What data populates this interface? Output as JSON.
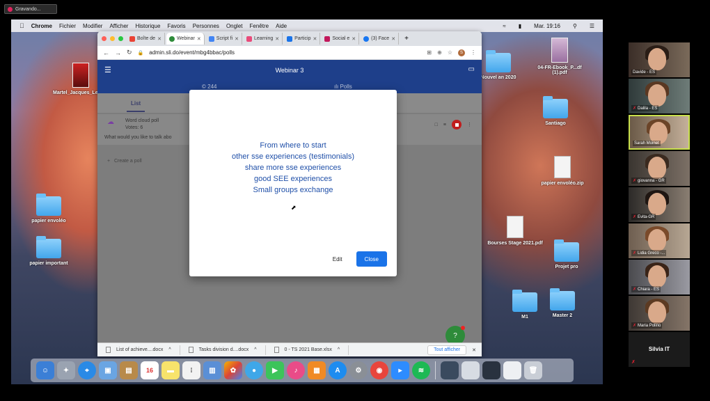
{
  "recording": {
    "label": "Gravando..."
  },
  "menubar": {
    "app": "Chrome",
    "items": [
      "Fichier",
      "Modifier",
      "Afficher",
      "Historique",
      "Favoris",
      "Personnes",
      "Onglet",
      "Fenêtre",
      "Aide"
    ],
    "clock": "Mar. 19:16"
  },
  "desktop": {
    "icons": [
      "Martel_Jacques_Le_grand_ladie",
      "papier envoléo",
      "papier important",
      "Nouvel an 2020",
      "Santiago",
      "papier envoléo.zip",
      "Bourses Stage 2021.pdf",
      "Projet pro",
      "M1",
      "Master 2",
      "04-FR-Ebook_P...df (1).pdf"
    ]
  },
  "chrome": {
    "tabs": [
      {
        "label": "Boîte de"
      },
      {
        "label": "Webinar"
      },
      {
        "label": "Script fi"
      },
      {
        "label": "Learning"
      },
      {
        "label": "Particip"
      },
      {
        "label": "Social e"
      },
      {
        "label": "(3) Face"
      }
    ],
    "url": "admin.sli.do/event/mbg4bbac/polls",
    "profile_initial": "S"
  },
  "page": {
    "title": "Webinar 3",
    "sub_left": "© 244",
    "sub_right": "ılı Polls",
    "tab_list": "List",
    "poll": {
      "type": "Word cloud poll",
      "votes": "Votes: 6",
      "question": "What would you like to talk abo"
    },
    "create": "Create a poll"
  },
  "modal": {
    "answers": [
      "From where to start",
      "other sse experiences (testimonials)",
      "share more sse experiences",
      "good SEE experiences",
      "Small groups exchange"
    ],
    "edit": "Edit",
    "close": "Close"
  },
  "downloads": {
    "files": [
      "List of achieve....docx",
      "Tasks division d....docx",
      "0 - TS 2021 Base.xlsx"
    ],
    "show_all": "Tout afficher"
  },
  "dock": {
    "calendar_day": "16"
  },
  "participants": [
    {
      "name": "Davide - ES"
    },
    {
      "name": "Dalila - ES"
    },
    {
      "name": "Sarah Moinet"
    },
    {
      "name": "giovanna - GR"
    },
    {
      "name": "Evita-GR"
    },
    {
      "name": "Lidia Greco -..."
    },
    {
      "name": "Chiara - ES"
    },
    {
      "name": "Maria Polino"
    },
    {
      "name": "Silvia IT"
    }
  ]
}
